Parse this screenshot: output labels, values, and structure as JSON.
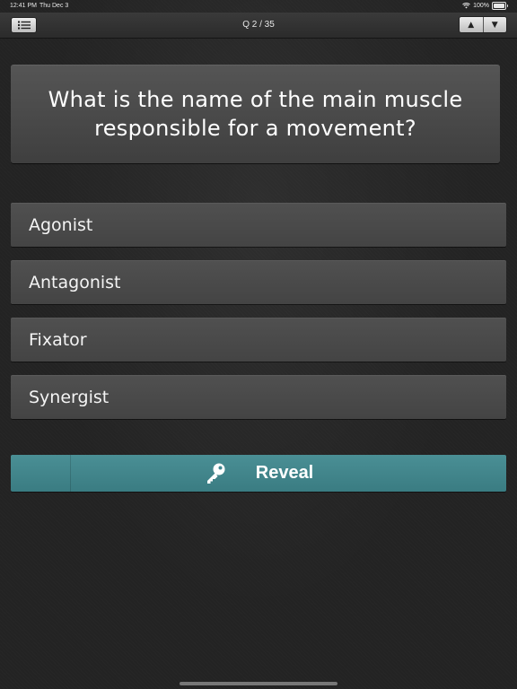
{
  "status_bar": {
    "time": "12:41 PM",
    "date": "Thu Dec 3",
    "battery": "100%",
    "wifi_icon": "wifi-icon",
    "battery_icon": "battery-icon"
  },
  "nav": {
    "title": "Q 2 / 35",
    "menu_icon": "list-icon",
    "up_arrow": "▲",
    "down_arrow": "▼"
  },
  "question": {
    "text": "What is the name of the main muscle responsible for a movement?"
  },
  "answers": [
    {
      "label": "Agonist"
    },
    {
      "label": "Antagonist"
    },
    {
      "label": "Fixator"
    },
    {
      "label": "Synergist"
    }
  ],
  "reveal": {
    "label": "Reveal",
    "icon": "key-icon",
    "color": "#418791"
  }
}
